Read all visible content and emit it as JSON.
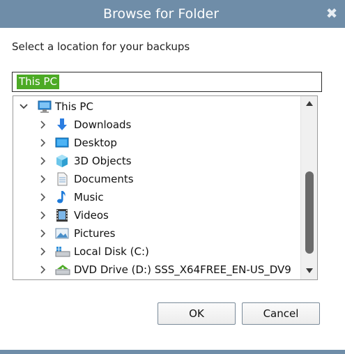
{
  "window": {
    "title": "Browse for Folder",
    "close_glyph": "✖"
  },
  "instruction": "Select a location for your backups",
  "path_field": {
    "value": "This PC"
  },
  "tree": {
    "root": {
      "label": "This PC",
      "icon": "computer-icon",
      "expanded": true
    },
    "items": [
      {
        "label": "Downloads",
        "icon": "downloads-icon"
      },
      {
        "label": "Desktop",
        "icon": "desktop-icon"
      },
      {
        "label": "3D Objects",
        "icon": "3d-objects-icon"
      },
      {
        "label": "Documents",
        "icon": "documents-icon"
      },
      {
        "label": "Music",
        "icon": "music-icon"
      },
      {
        "label": "Videos",
        "icon": "videos-icon"
      },
      {
        "label": "Pictures",
        "icon": "pictures-icon"
      },
      {
        "label": "Local Disk (C:)",
        "icon": "local-disk-icon"
      },
      {
        "label": "DVD Drive (D:) SSS_X64FREE_EN-US_DV9",
        "icon": "dvd-drive-icon"
      }
    ]
  },
  "buttons": {
    "ok": "OK",
    "cancel": "Cancel"
  },
  "colors": {
    "titlebar": "#6f8da8",
    "selection": "#4caa25"
  }
}
